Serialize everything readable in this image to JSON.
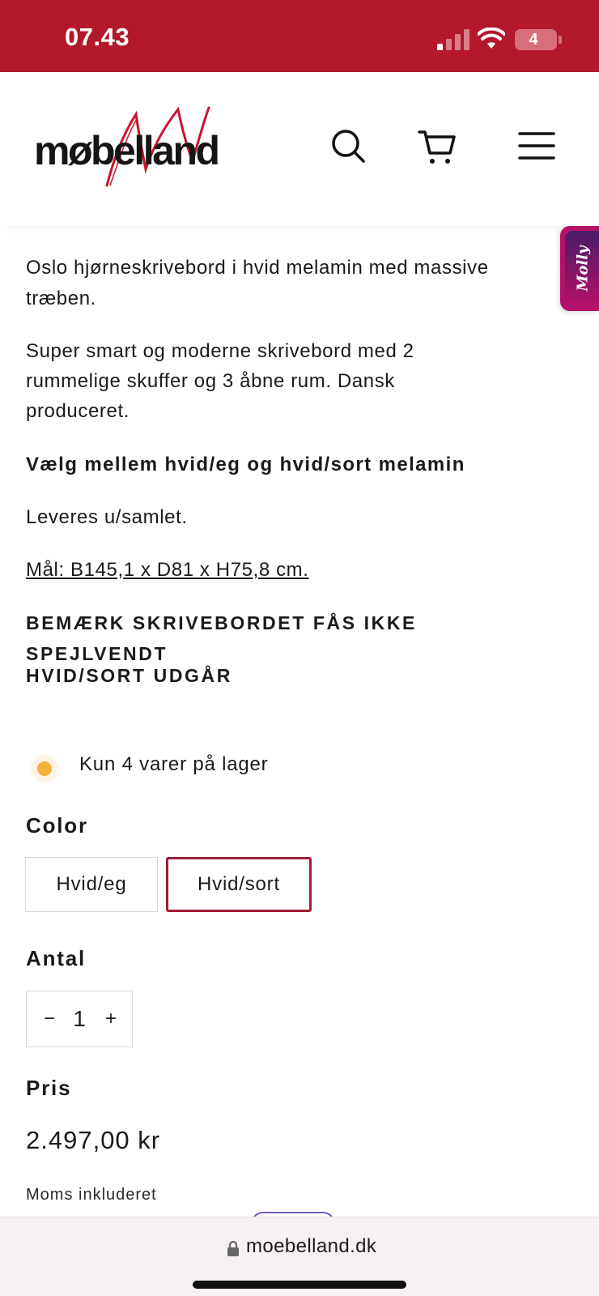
{
  "status_bar": {
    "time": "07.43",
    "battery": "4"
  },
  "header": {
    "logo_text": "møbelland",
    "icons": [
      "search-icon",
      "cart-icon",
      "menu-icon"
    ]
  },
  "molly_tab": {
    "label": "Molly"
  },
  "description": {
    "p1": "Oslo hjørneskrivebord i hvid melamin med massive",
    "p1b": "træben.",
    "p2a": "Super smart og moderne skrivebord med 2",
    "p2b": "rummelige skuffer og 3 åbne rum. Dansk",
    "p2c": "produceret.",
    "choice": "Vælg mellem hvid/eg og hvid/sort melamin",
    "delivery": "Leveres u/samlet.",
    "dimensions": "Mål: B145,1 x D81 x H75,8 cm.",
    "notice1": "BEMÆRK SKRIVEBORDET FÅS IKKE SPEJLVENDT",
    "notice2": "HVID/SORT UDGÅR"
  },
  "stock": {
    "text": "Kun 4 varer på lager",
    "status_color": "#f2b33b"
  },
  "color_option": {
    "label": "Color",
    "options": [
      "Hvid/eg",
      "Hvid/sort"
    ],
    "selected": "Hvid/sort"
  },
  "quantity": {
    "label": "Antal",
    "minus": "−",
    "value": "1",
    "plus": "+"
  },
  "price": {
    "label": "Pris",
    "value": "2.497,00 kr",
    "vat_note": "Moms inkluderet"
  },
  "browser": {
    "url": "moebelland.dk"
  },
  "colors": {
    "brand_red": "#b4182d",
    "selected_border": "#a31d36",
    "molly_magenta": "#b4126a"
  }
}
